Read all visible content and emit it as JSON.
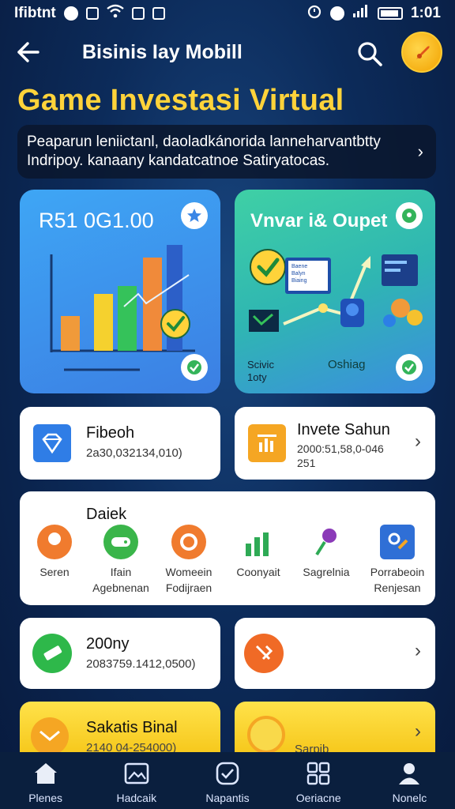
{
  "status_bar": {
    "left_text": "Ifibtnt",
    "time": "1:01"
  },
  "app_bar": {
    "title": "Bisinis Iay Mobill"
  },
  "headline": "Game Investasi Virtual",
  "banner": {
    "line1": "Peaparun leniictanl, daoladkánorida lanneharvantbtty",
    "line2": "Indripoy. kanaany kandatcatnoe Satiryatocas."
  },
  "portfolio_card": {
    "value": "R51 0G1.00"
  },
  "growth_card": {
    "title": "Vnvar i& Oupet",
    "left_label_line1": "Scivic",
    "left_label_line2": "1oty",
    "right_label": "Oshiag",
    "doc_text": "Baene\nBalyn\nBiaing"
  },
  "stat_cards": [
    {
      "title": "Fibeoh",
      "sub": "2a30,032134,010)",
      "icon_color": "#2f7de6"
    },
    {
      "title": "Invete Sahun",
      "sub": "2000:51,58,0-046\n251",
      "icon_color": "#f5a623"
    }
  ],
  "categories": {
    "title": "Daiek",
    "items": [
      {
        "label_line1": "Seren",
        "label_line2": "",
        "color": "#f07b2e",
        "icon": "map-pin-icon"
      },
      {
        "label_line1": "Ifain",
        "label_line2": "Agebnenan",
        "color": "#3ab54a",
        "icon": "gamepad-icon"
      },
      {
        "label_line1": "Womeein",
        "label_line2": "Fodijraen",
        "color": "#f07b2e",
        "icon": "ring-icon"
      },
      {
        "label_line1": "Coonyait",
        "label_line2": "",
        "color": "#2eaa55",
        "icon": "bar-chart-icon"
      },
      {
        "label_line1": "Sagrelnia",
        "label_line2": "",
        "color": "#8b3ab8",
        "icon": "lollipop-icon"
      },
      {
        "label_line1": "Porrabeoin",
        "label_line2": "Renjesan",
        "color": "#2f6fd6",
        "icon": "puzzle-icon"
      }
    ]
  },
  "lower_cards": [
    {
      "title": "200ny",
      "sub": "2083759.1412,0500)",
      "icon_color": "#2eb84a"
    },
    {
      "title": "",
      "sub": "",
      "icon_color": "#f06a26"
    }
  ],
  "yellow_cards": [
    {
      "title": "Sakatis Binal",
      "sub": "2140 04-254000)"
    },
    {
      "title": "",
      "sub": "Sarpib"
    }
  ],
  "bottom_nav": [
    {
      "label": "Plenes",
      "icon": "home-icon"
    },
    {
      "label": "Hadcaik",
      "icon": "image-icon"
    },
    {
      "label": "Napantis",
      "icon": "check-badge-icon"
    },
    {
      "label": "Oeriacne",
      "icon": "grid-icon"
    },
    {
      "label": "Nonelc",
      "icon": "profile-icon"
    }
  ]
}
